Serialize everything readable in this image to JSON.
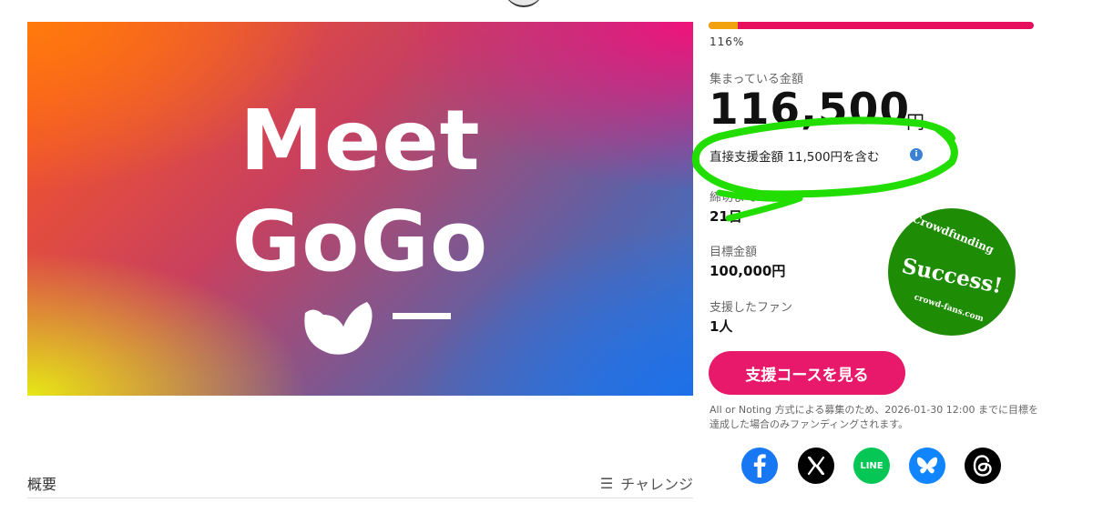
{
  "hero": {
    "line1": "Meet",
    "line2": "GoGo"
  },
  "stats": {
    "progress_percent_label": "116%",
    "progress_fraction": 0.09,
    "raised_label": "集まっている金額",
    "raised_amount": "116,500",
    "currency": "円",
    "direct_support": "直接支援金額 11,500円を含む",
    "deadline_label": "締切まで",
    "deadline_value": "21日",
    "goal_label": "目標金額",
    "goal_value": "100,000円",
    "fans_label": "支援したファン",
    "fans_value": "1人"
  },
  "stamp": {
    "top": "Crowdfunding",
    "middle": "Success!",
    "bottom": "crowd-fans.com"
  },
  "cta_label": "支援コースを見る",
  "note": "All or Noting 方式による募集のため、2026-01-30 12:00 までに目標を達成した場合のみファンディングされます。",
  "share": {
    "icons": [
      "facebook-icon",
      "x-icon",
      "line-icon",
      "bluesky-icon",
      "threads-icon"
    ],
    "line_text": "LINE"
  },
  "tabs": {
    "overview": "概要",
    "menu": "チャレンジ"
  },
  "colors": {
    "accent": "#e8196a",
    "progress_fill": "#f3a20f",
    "stamp_green": "#1f8c05",
    "annotation_green": "#22dd00"
  }
}
